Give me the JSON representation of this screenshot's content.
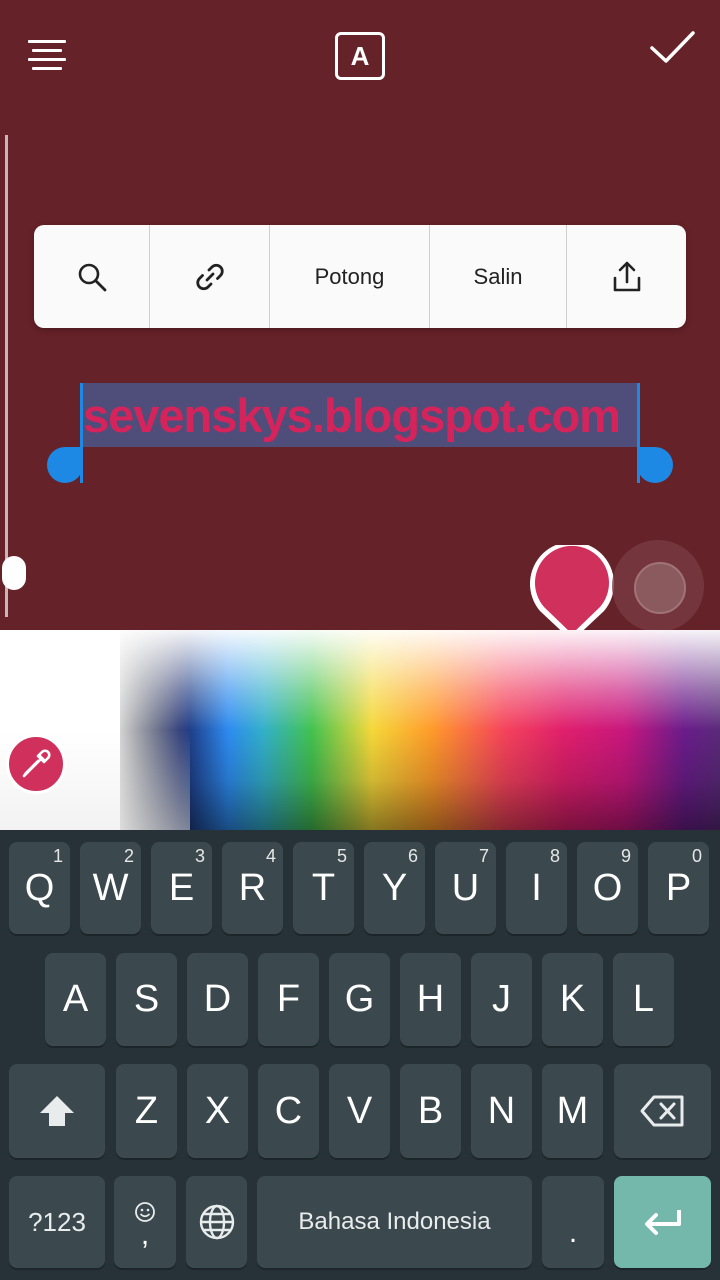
{
  "toolbar": {
    "text_style_label": "A"
  },
  "context_menu": {
    "cut_label": "Potong",
    "copy_label": "Salin"
  },
  "editor": {
    "selected_text": "sevenskys.blogspot.com"
  },
  "colors": {
    "background": "#652228",
    "selected_text_color": "#d4245b",
    "selection_highlight": "#4f4d79",
    "selection_handle": "#1e88e5",
    "current_color": "#d0315c",
    "keyboard_bg": "#263238",
    "key_bg": "#3b484e",
    "enter_key": "#74b8ac"
  },
  "icons": {
    "menu": "menu-icon",
    "confirm": "check-icon",
    "search": "search-icon",
    "link": "link-icon",
    "share": "share-icon",
    "eyedropper": "eyedropper-icon",
    "shift": "shift-icon",
    "backspace": "backspace-icon",
    "globe": "globe-icon",
    "enter": "enter-icon",
    "emoji": "emoji-icon"
  },
  "keyboard": {
    "row1": [
      {
        "label": "Q",
        "hint": "1"
      },
      {
        "label": "W",
        "hint": "2"
      },
      {
        "label": "E",
        "hint": "3"
      },
      {
        "label": "R",
        "hint": "4"
      },
      {
        "label": "T",
        "hint": "5"
      },
      {
        "label": "Y",
        "hint": "6"
      },
      {
        "label": "U",
        "hint": "7"
      },
      {
        "label": "I",
        "hint": "8"
      },
      {
        "label": "O",
        "hint": "9"
      },
      {
        "label": "P",
        "hint": "0"
      }
    ],
    "row2": [
      "A",
      "S",
      "D",
      "F",
      "G",
      "H",
      "J",
      "K",
      "L"
    ],
    "row3": [
      "Z",
      "X",
      "C",
      "V",
      "B",
      "N",
      "M"
    ],
    "symbols_label": "?123",
    "comma_label": ",",
    "space_label": "Bahasa Indonesia",
    "period_label": "."
  }
}
